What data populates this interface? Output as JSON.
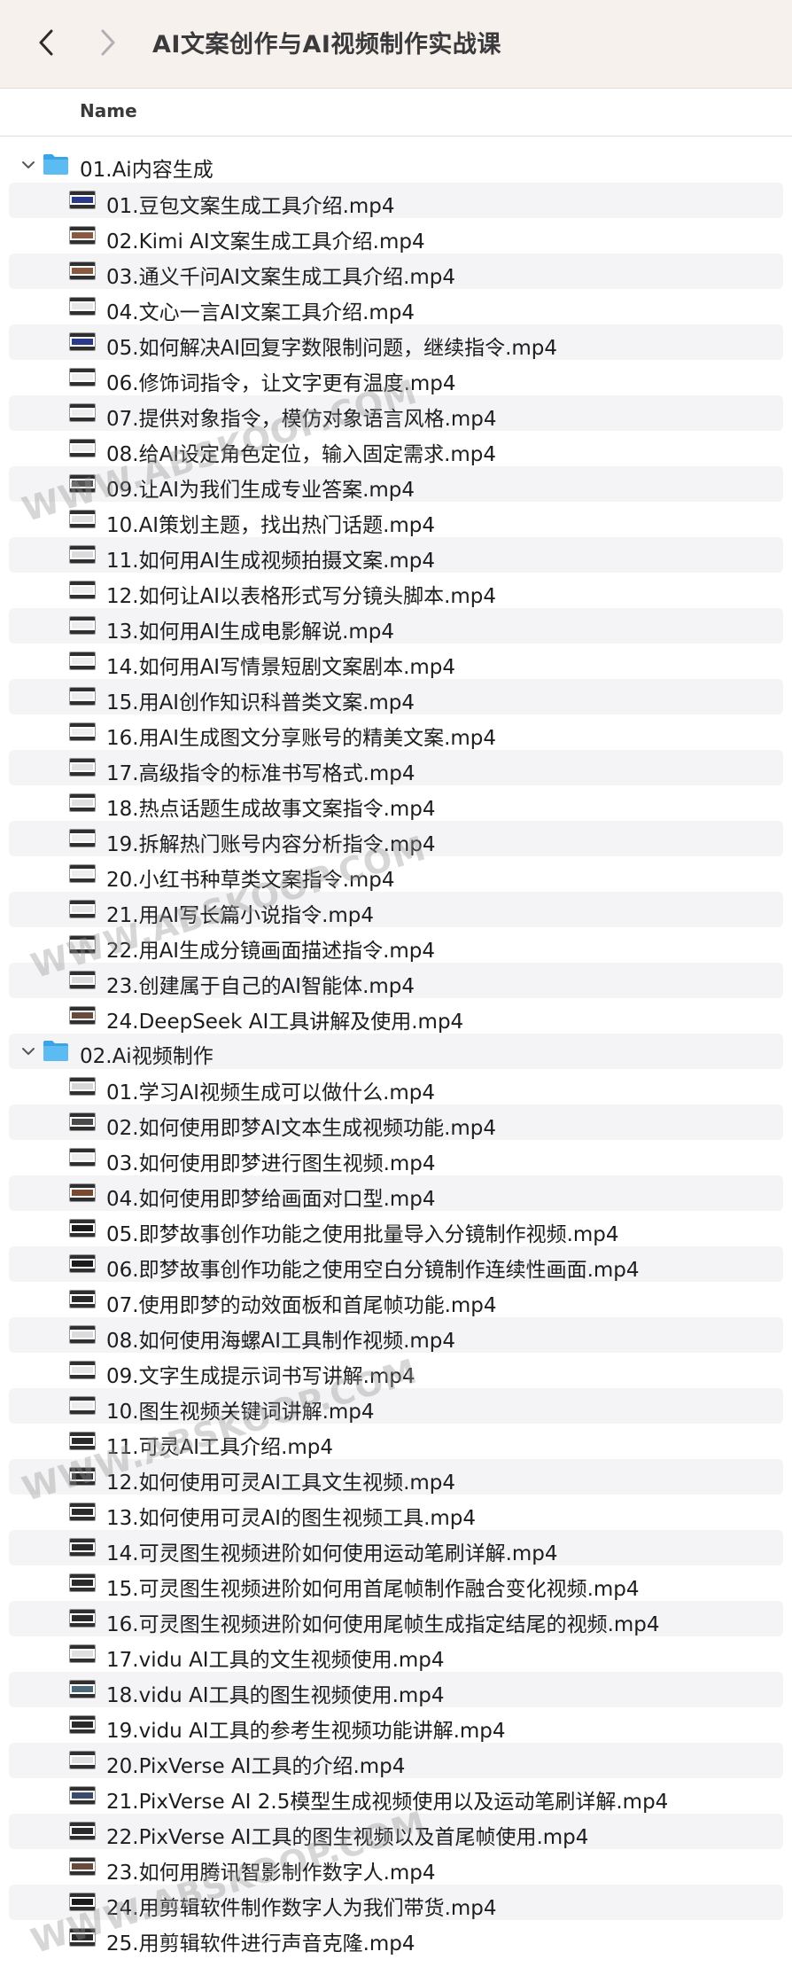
{
  "window": {
    "title": "AI文案创作与AI视频制作实战课",
    "back_icon": "chevron-left-icon",
    "forward_icon": "chevron-right-icon"
  },
  "columns": {
    "name": "Name"
  },
  "colors": {
    "toolbar_bg": "#f6f1ec",
    "folder_blue": "#4fb3ee",
    "stripe": "#f4f4f6"
  },
  "watermark": "WWW.ABSKOOP.COM",
  "folders": [
    {
      "label": "01.Ai内容生成",
      "expanded": true,
      "files": [
        {
          "label": "01.豆包文案生成工具介绍.mp4",
          "thumb": "#2b3a8a"
        },
        {
          "label": "02.Kimi AI文案生成工具介绍.mp4",
          "thumb": "#8a5a40"
        },
        {
          "label": "03.通义千问AI文案生成工具介绍.mp4",
          "thumb": "#8a5a40"
        },
        {
          "label": "04.文心一言AI文案工具介绍.mp4",
          "thumb": "#e8e8e8"
        },
        {
          "label": "05.如何解决AI回复字数限制问题，继续指令.mp4",
          "thumb": "#2b3a8a"
        },
        {
          "label": "06.修饰词指令，让文字更有温度.mp4",
          "thumb": "#ededed"
        },
        {
          "label": "07.提供对象指令，模仿对象语言风格.mp4",
          "thumb": "#ededed"
        },
        {
          "label": "08.给AI设定角色定位，输入固定需求.mp4",
          "thumb": "#ededed"
        },
        {
          "label": "09.让AI为我们生成专业答案.mp4",
          "thumb": "#555555"
        },
        {
          "label": "10.AI策划主题，找出热门话题.mp4",
          "thumb": "#e0e0e0"
        },
        {
          "label": "11.如何用AI生成视频拍摄文案.mp4",
          "thumb": "#dcdcdc"
        },
        {
          "label": "12.如何让AI以表格形式写分镜头脚本.mp4",
          "thumb": "#ededed"
        },
        {
          "label": "13.如何用AI生成电影解说.mp4",
          "thumb": "#ededed"
        },
        {
          "label": "14.如何用AI写情景短剧文案剧本.mp4",
          "thumb": "#ededed"
        },
        {
          "label": "15.用AI创作知识科普类文案.mp4",
          "thumb": "#ededed"
        },
        {
          "label": "16.用AI生成图文分享账号的精美文案.mp4",
          "thumb": "#ededed"
        },
        {
          "label": "17.高级指令的标准书写格式.mp4",
          "thumb": "#e0e0e0"
        },
        {
          "label": "18.热点话题生成故事文案指令.mp4",
          "thumb": "#e0e0e0"
        },
        {
          "label": "19.拆解热门账号内容分析指令.mp4",
          "thumb": "#ededed"
        },
        {
          "label": "20.小红书种草类文案指令.mp4",
          "thumb": "#ededed"
        },
        {
          "label": "21.用AI写长篇小说指令.mp4",
          "thumb": "#e6e6e6"
        },
        {
          "label": "22.用AI生成分镜画面描述指令.mp4",
          "thumb": "#ededed"
        },
        {
          "label": "23.创建属于自己的AI智能体.mp4",
          "thumb": "#dcdcdc"
        },
        {
          "label": "24.DeepSeek AI工具讲解及使用.mp4",
          "thumb": "#6a4a3a"
        }
      ]
    },
    {
      "label": "02.Ai视频制作",
      "expanded": true,
      "files": [
        {
          "label": "01.学习AI视频生成可以做什么.mp4",
          "thumb": "#d8d8d8"
        },
        {
          "label": "02.如何使用即梦AI文本生成视频功能.mp4",
          "thumb": "#4a4a4a"
        },
        {
          "label": "03.如何使用即梦进行图生视频.mp4",
          "thumb": "#ededed"
        },
        {
          "label": "04.如何使用即梦给画面对口型.mp4",
          "thumb": "#7a4a30"
        },
        {
          "label": "05.即梦故事创作功能之使用批量导入分镜制作视频.mp4",
          "thumb": "#1a1a1a"
        },
        {
          "label": "06.即梦故事创作功能之使用空白分镜制作连续性画面.mp4",
          "thumb": "#1a1a1a"
        },
        {
          "label": "07.使用即梦的动效面板和首尾帧功能.mp4",
          "thumb": "#2a2a2a"
        },
        {
          "label": "08.如何使用海螺AI工具制作视频.mp4",
          "thumb": "#dcdcdc"
        },
        {
          "label": "09.文字生成提示词书写讲解.mp4",
          "thumb": "#e6e6e6"
        },
        {
          "label": "10.图生视频关键词讲解.mp4",
          "thumb": "#ededed"
        },
        {
          "label": "11.可灵AI工具介绍.mp4",
          "thumb": "#2a2a2a"
        },
        {
          "label": "12.如何使用可灵AI工具文生视频.mp4",
          "thumb": "#2a2a2a"
        },
        {
          "label": "13.如何使用可灵AI的图生视频工具.mp4",
          "thumb": "#2a2a2a"
        },
        {
          "label": "14.可灵图生视频进阶如何使用运动笔刷详解.mp4",
          "thumb": "#2a2a2a"
        },
        {
          "label": "15.可灵图生视频进阶如何用首尾帧制作融合变化视频.mp4",
          "thumb": "#2a2a2a"
        },
        {
          "label": "16.可灵图生视频进阶如何使用尾帧生成指定结尾的视频.mp4",
          "thumb": "#2a2a2a"
        },
        {
          "label": "17.vidu AI工具的文生视频使用.mp4",
          "thumb": "#e0e0e0"
        },
        {
          "label": "18.vidu AI工具的图生视频使用.mp4",
          "thumb": "#4a6a7a"
        },
        {
          "label": "19.vidu AI工具的参考生视频功能讲解.mp4",
          "thumb": "#2a2a2a"
        },
        {
          "label": "20.PixVerse AI工具的介绍.mp4",
          "thumb": "#e0e0e0"
        },
        {
          "label": "21.PixVerse AI 2.5模型生成视频使用以及运动笔刷详解.mp4",
          "thumb": "#3a4a6a"
        },
        {
          "label": "22.PixVerse AI工具的图生视频以及首尾帧使用.mp4",
          "thumb": "#2a2a2a"
        },
        {
          "label": "23.如何用腾讯智影制作数字人.mp4",
          "thumb": "#6a4a3a"
        },
        {
          "label": "24.用剪辑软件制作数字人为我们带货.mp4",
          "thumb": "#1a1a1a"
        },
        {
          "label": "25.用剪辑软件进行声音克隆.mp4",
          "thumb": "#2a2a2a"
        }
      ]
    }
  ]
}
